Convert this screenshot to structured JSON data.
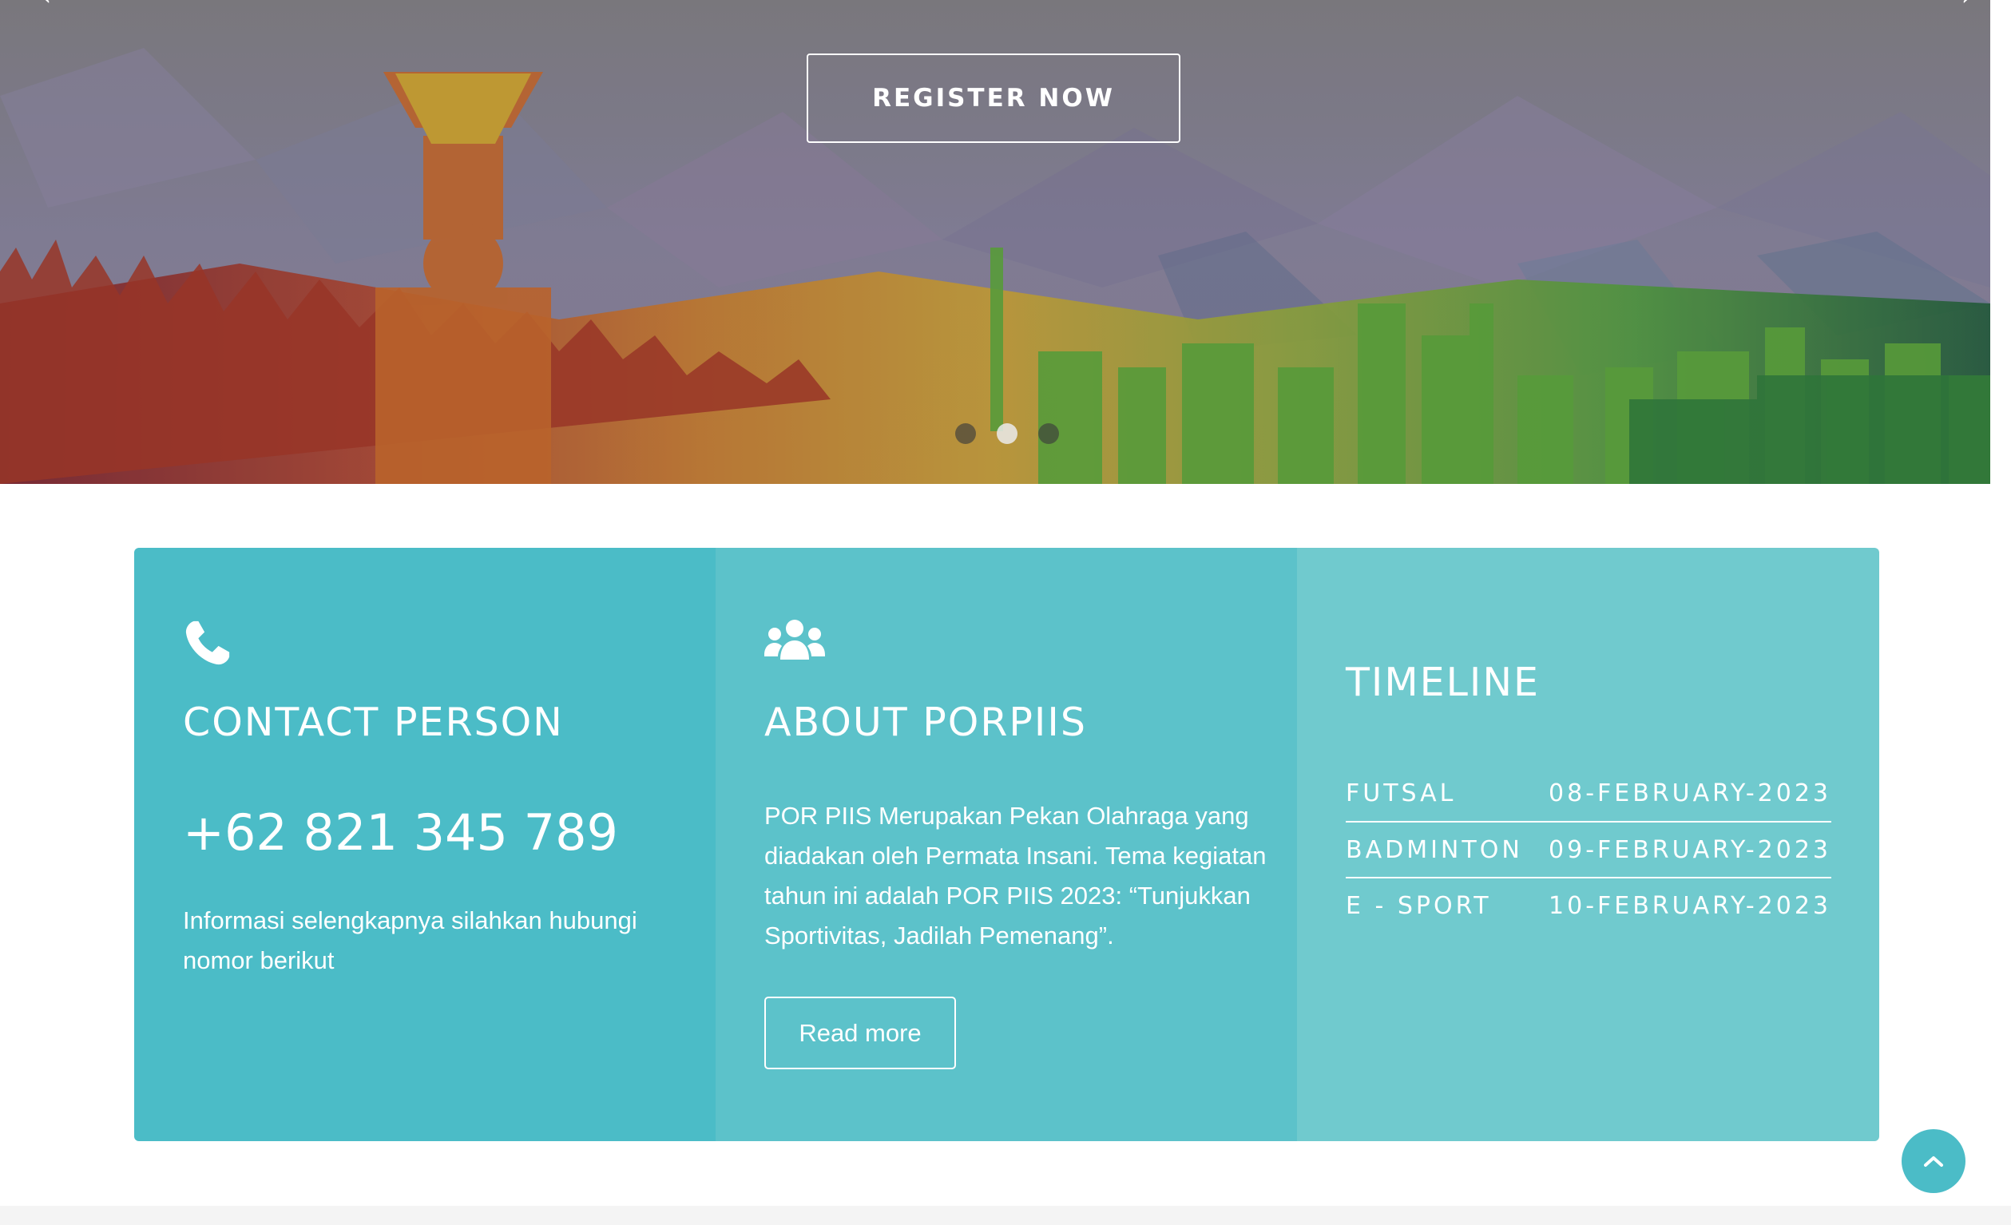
{
  "hero": {
    "register_label": "REGISTER NOW",
    "prev_arrow": "‹",
    "next_arrow": "›",
    "slides": [
      {
        "active": false
      },
      {
        "active": true
      },
      {
        "active": false
      }
    ]
  },
  "contact": {
    "icon": "phone-icon",
    "title": "CONTACT PERSON",
    "phone": "+62 821 345 789",
    "description": "Informasi selengkapnya silahkan hubungi nomor berikut"
  },
  "about": {
    "icon": "users-icon",
    "title": "ABOUT PORPIIS",
    "description": "POR PIIS Merupakan Pekan Olahraga yang diadakan oleh Permata Insani. Tema kegiatan tahun ini adalah POR PIIS 2023: “Tunjukkan Sportivitas, Jadilah Pemenang”.",
    "button_label": "Read more"
  },
  "timeline": {
    "title": "TIMELINE",
    "items": [
      {
        "event": "FUTSAL",
        "date": "08-FEBRUARY-2023"
      },
      {
        "event": "BADMINTON",
        "date": "09-FEBRUARY-2023"
      },
      {
        "event": "E - SPORT",
        "date": "10-FEBRUARY-2023"
      }
    ]
  },
  "back_to_top": {
    "icon": "chevron-up-icon"
  },
  "colors": {
    "panel_1": "#4bbcc7",
    "panel_2": "#5cc2ca",
    "panel_3": "#70cace",
    "text": "#ffffff"
  }
}
